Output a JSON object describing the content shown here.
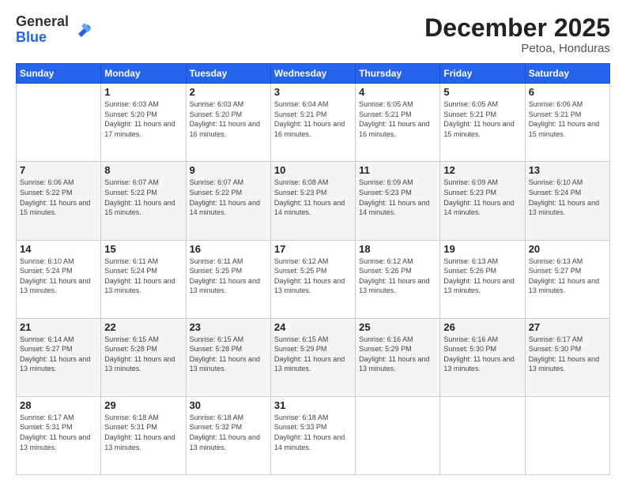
{
  "logo": {
    "general": "General",
    "blue": "Blue"
  },
  "header": {
    "month": "December 2025",
    "location": "Petoa, Honduras"
  },
  "weekdays": [
    "Sunday",
    "Monday",
    "Tuesday",
    "Wednesday",
    "Thursday",
    "Friday",
    "Saturday"
  ],
  "weeks": [
    [
      {
        "day": "",
        "sunrise": "",
        "sunset": "",
        "daylight": ""
      },
      {
        "day": "1",
        "sunrise": "Sunrise: 6:03 AM",
        "sunset": "Sunset: 5:20 PM",
        "daylight": "Daylight: 11 hours and 17 minutes."
      },
      {
        "day": "2",
        "sunrise": "Sunrise: 6:03 AM",
        "sunset": "Sunset: 5:20 PM",
        "daylight": "Daylight: 11 hours and 16 minutes."
      },
      {
        "day": "3",
        "sunrise": "Sunrise: 6:04 AM",
        "sunset": "Sunset: 5:21 PM",
        "daylight": "Daylight: 11 hours and 16 minutes."
      },
      {
        "day": "4",
        "sunrise": "Sunrise: 6:05 AM",
        "sunset": "Sunset: 5:21 PM",
        "daylight": "Daylight: 11 hours and 16 minutes."
      },
      {
        "day": "5",
        "sunrise": "Sunrise: 6:05 AM",
        "sunset": "Sunset: 5:21 PM",
        "daylight": "Daylight: 11 hours and 15 minutes."
      },
      {
        "day": "6",
        "sunrise": "Sunrise: 6:06 AM",
        "sunset": "Sunset: 5:21 PM",
        "daylight": "Daylight: 11 hours and 15 minutes."
      }
    ],
    [
      {
        "day": "7",
        "sunrise": "Sunrise: 6:06 AM",
        "sunset": "Sunset: 5:22 PM",
        "daylight": "Daylight: 11 hours and 15 minutes."
      },
      {
        "day": "8",
        "sunrise": "Sunrise: 6:07 AM",
        "sunset": "Sunset: 5:22 PM",
        "daylight": "Daylight: 11 hours and 15 minutes."
      },
      {
        "day": "9",
        "sunrise": "Sunrise: 6:07 AM",
        "sunset": "Sunset: 5:22 PM",
        "daylight": "Daylight: 11 hours and 14 minutes."
      },
      {
        "day": "10",
        "sunrise": "Sunrise: 6:08 AM",
        "sunset": "Sunset: 5:23 PM",
        "daylight": "Daylight: 11 hours and 14 minutes."
      },
      {
        "day": "11",
        "sunrise": "Sunrise: 6:09 AM",
        "sunset": "Sunset: 5:23 PM",
        "daylight": "Daylight: 11 hours and 14 minutes."
      },
      {
        "day": "12",
        "sunrise": "Sunrise: 6:09 AM",
        "sunset": "Sunset: 5:23 PM",
        "daylight": "Daylight: 11 hours and 14 minutes."
      },
      {
        "day": "13",
        "sunrise": "Sunrise: 6:10 AM",
        "sunset": "Sunset: 5:24 PM",
        "daylight": "Daylight: 11 hours and 13 minutes."
      }
    ],
    [
      {
        "day": "14",
        "sunrise": "Sunrise: 6:10 AM",
        "sunset": "Sunset: 5:24 PM",
        "daylight": "Daylight: 11 hours and 13 minutes."
      },
      {
        "day": "15",
        "sunrise": "Sunrise: 6:11 AM",
        "sunset": "Sunset: 5:24 PM",
        "daylight": "Daylight: 11 hours and 13 minutes."
      },
      {
        "day": "16",
        "sunrise": "Sunrise: 6:11 AM",
        "sunset": "Sunset: 5:25 PM",
        "daylight": "Daylight: 11 hours and 13 minutes."
      },
      {
        "day": "17",
        "sunrise": "Sunrise: 6:12 AM",
        "sunset": "Sunset: 5:25 PM",
        "daylight": "Daylight: 11 hours and 13 minutes."
      },
      {
        "day": "18",
        "sunrise": "Sunrise: 6:12 AM",
        "sunset": "Sunset: 5:26 PM",
        "daylight": "Daylight: 11 hours and 13 minutes."
      },
      {
        "day": "19",
        "sunrise": "Sunrise: 6:13 AM",
        "sunset": "Sunset: 5:26 PM",
        "daylight": "Daylight: 11 hours and 13 minutes."
      },
      {
        "day": "20",
        "sunrise": "Sunrise: 6:13 AM",
        "sunset": "Sunset: 5:27 PM",
        "daylight": "Daylight: 11 hours and 13 minutes."
      }
    ],
    [
      {
        "day": "21",
        "sunrise": "Sunrise: 6:14 AM",
        "sunset": "Sunset: 5:27 PM",
        "daylight": "Daylight: 11 hours and 13 minutes."
      },
      {
        "day": "22",
        "sunrise": "Sunrise: 6:15 AM",
        "sunset": "Sunset: 5:28 PM",
        "daylight": "Daylight: 11 hours and 13 minutes."
      },
      {
        "day": "23",
        "sunrise": "Sunrise: 6:15 AM",
        "sunset": "Sunset: 5:28 PM",
        "daylight": "Daylight: 11 hours and 13 minutes."
      },
      {
        "day": "24",
        "sunrise": "Sunrise: 6:15 AM",
        "sunset": "Sunset: 5:29 PM",
        "daylight": "Daylight: 11 hours and 13 minutes."
      },
      {
        "day": "25",
        "sunrise": "Sunrise: 6:16 AM",
        "sunset": "Sunset: 5:29 PM",
        "daylight": "Daylight: 11 hours and 13 minutes."
      },
      {
        "day": "26",
        "sunrise": "Sunrise: 6:16 AM",
        "sunset": "Sunset: 5:30 PM",
        "daylight": "Daylight: 11 hours and 13 minutes."
      },
      {
        "day": "27",
        "sunrise": "Sunrise: 6:17 AM",
        "sunset": "Sunset: 5:30 PM",
        "daylight": "Daylight: 11 hours and 13 minutes."
      }
    ],
    [
      {
        "day": "28",
        "sunrise": "Sunrise: 6:17 AM",
        "sunset": "Sunset: 5:31 PM",
        "daylight": "Daylight: 11 hours and 13 minutes."
      },
      {
        "day": "29",
        "sunrise": "Sunrise: 6:18 AM",
        "sunset": "Sunset: 5:31 PM",
        "daylight": "Daylight: 11 hours and 13 minutes."
      },
      {
        "day": "30",
        "sunrise": "Sunrise: 6:18 AM",
        "sunset": "Sunset: 5:32 PM",
        "daylight": "Daylight: 11 hours and 13 minutes."
      },
      {
        "day": "31",
        "sunrise": "Sunrise: 6:18 AM",
        "sunset": "Sunset: 5:33 PM",
        "daylight": "Daylight: 11 hours and 14 minutes."
      },
      {
        "day": "",
        "sunrise": "",
        "sunset": "",
        "daylight": ""
      },
      {
        "day": "",
        "sunrise": "",
        "sunset": "",
        "daylight": ""
      },
      {
        "day": "",
        "sunrise": "",
        "sunset": "",
        "daylight": ""
      }
    ]
  ]
}
